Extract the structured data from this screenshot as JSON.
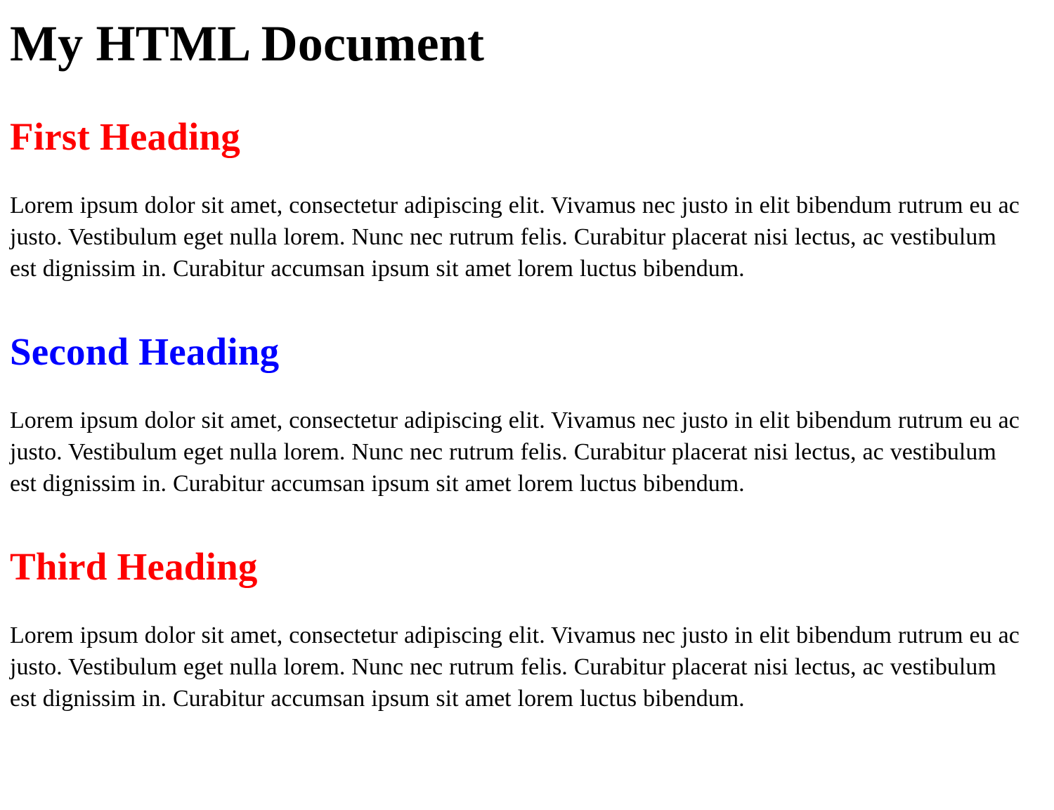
{
  "document": {
    "title": "My HTML Document",
    "background_color": "#ffffff",
    "text_color": "#000000",
    "sections": [
      {
        "heading": "First Heading",
        "heading_color": "#ff0000",
        "paragraph": "Lorem ipsum dolor sit amet, consectetur adipiscing elit. Vivamus nec justo in elit bibendum rutrum eu ac justo. Vestibulum eget nulla lorem. Nunc nec rutrum felis. Curabitur placerat nisi lectus, ac vestibulum est dignissim in. Curabitur accumsan ipsum sit amet lorem luctus bibendum."
      },
      {
        "heading": "Second Heading",
        "heading_color": "#0000ff",
        "paragraph": "Lorem ipsum dolor sit amet, consectetur adipiscing elit. Vivamus nec justo in elit bibendum rutrum eu ac justo. Vestibulum eget nulla lorem. Nunc nec rutrum felis. Curabitur placerat nisi lectus, ac vestibulum est dignissim in. Curabitur accumsan ipsum sit amet lorem luctus bibendum."
      },
      {
        "heading": "Third Heading",
        "heading_color": "#ff0000",
        "paragraph": "Lorem ipsum dolor sit amet, consectetur adipiscing elit. Vivamus nec justo in elit bibendum rutrum eu ac justo. Vestibulum eget nulla lorem. Nunc nec rutrum felis. Curabitur placerat nisi lectus, ac vestibulum est dignissim in. Curabitur accumsan ipsum sit amet lorem luctus bibendum."
      }
    ]
  }
}
